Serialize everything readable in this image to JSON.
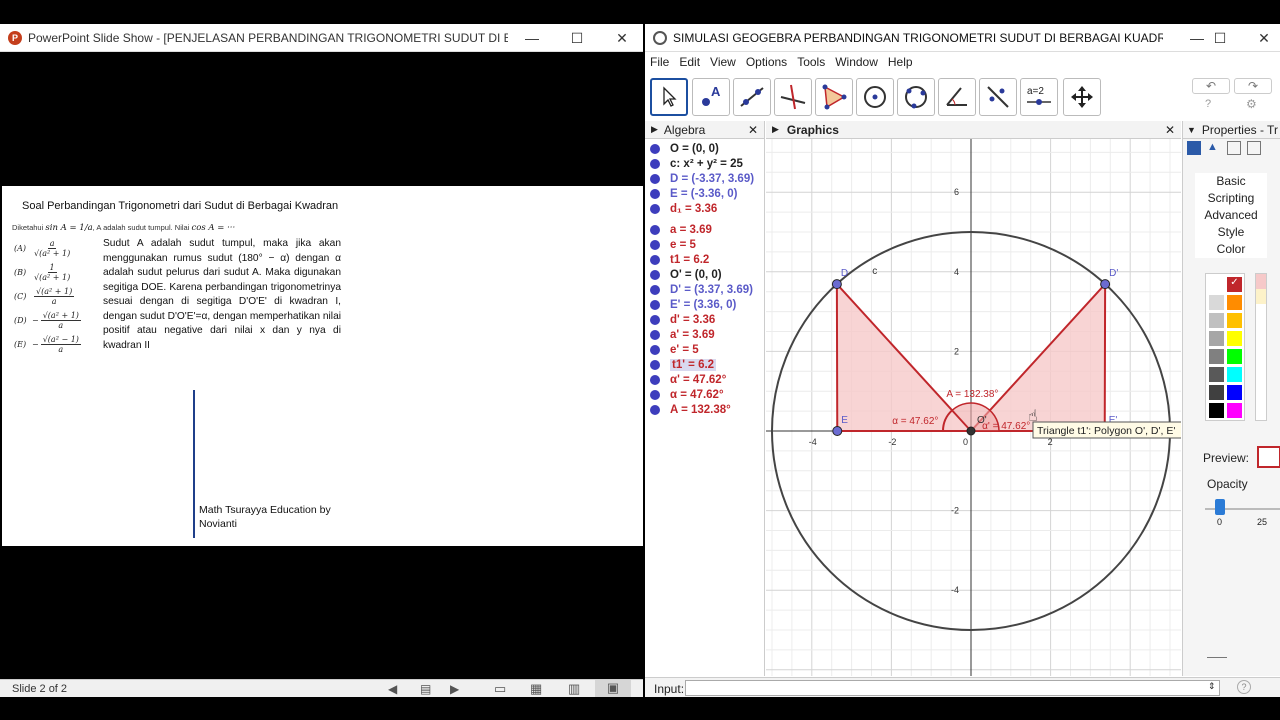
{
  "ppt": {
    "title": "PowerPoint Slide Show - [PENJELASAN PERBANDINGAN TRIGONOMETRI SUDUT DI BERBAGAI...",
    "slide_heading": "Soal Perbandingan Trigonometri dari Sudut di Berbagai Kwadran",
    "question_prefix": "Diketahui",
    "question_given": "sin A = 1/a",
    "question_mid": ", A adalah sudut tumpul. Nilai",
    "question_end": "cos A = ···",
    "options": [
      {
        "label": "(A)",
        "sign": "",
        "num": "a",
        "den": "√(a² + 1)"
      },
      {
        "label": "(B)",
        "sign": "",
        "num": "1",
        "den": "√(a² + 1)"
      },
      {
        "label": "(C)",
        "sign": "",
        "num": "√(a² + 1)",
        "den": "a"
      },
      {
        "label": "(D)",
        "sign": "−",
        "num": "√(a² + 1)",
        "den": "a"
      },
      {
        "label": "(E)",
        "sign": "−",
        "num": "√(a² − 1)",
        "den": "a"
      }
    ],
    "explanation": "Sudut A adalah sudut tumpul, maka jika akan menggunakan rumus sudut (180° − α) dengan α adalah sudut pelurus dari sudut A. Maka digunakan segitiga DOE. Karena perbandingan trigonometrinya sesuai dengan di segitiga D'O'E' di kwadran I, dengan sudut D'O'E'=α, dengan memperhatikan nilai positif atau negative dari nilai x dan y nya di kwadran II",
    "credit_line1": "Math Tsurayya Education by",
    "credit_line2": "Novianti",
    "status": "Slide 2 of 2"
  },
  "geogebra": {
    "title": "SIMULASI GEOGEBRA PERBANDINGAN TRIGONOMETRI SUDUT DI BERBAGAI KUADRAN.ggb",
    "menu": [
      "File",
      "Edit",
      "View",
      "Options",
      "Tools",
      "Window",
      "Help"
    ],
    "algebra_title": "Algebra",
    "graphics_title": "Graphics",
    "properties_title": "Properties - Tr",
    "algebra": [
      {
        "text": "O = (0, 0)",
        "color": "#222222",
        "dot": "#3d3dbd"
      },
      {
        "text": "c: x² + y² = 25",
        "color": "#222222",
        "dot": "#3d3dbd"
      },
      {
        "text": "D = (-3.37, 3.69)",
        "color": "#5a5ac8",
        "dot": "#3d3dbd"
      },
      {
        "text": "E = (-3.36, 0)",
        "color": "#5a5ac8",
        "dot": "#3d3dbd"
      },
      {
        "text": "d₁ = 3.36",
        "color": "#c0262b",
        "dot": "#3d3dbd"
      },
      {
        "text": "a = 3.69",
        "color": "#c0262b",
        "dot": "#3d3dbd"
      },
      {
        "text": "e = 5",
        "color": "#c0262b",
        "dot": "#3d3dbd"
      },
      {
        "text": "t1 = 6.2",
        "color": "#c0262b",
        "dot": "#3d3dbd"
      },
      {
        "text": "O' = (0, 0)",
        "color": "#222222",
        "dot": "#3d3dbd"
      },
      {
        "text": "D' = (3.37, 3.69)",
        "color": "#5a5ac8",
        "dot": "#3d3dbd"
      },
      {
        "text": "E' = (3.36, 0)",
        "color": "#5a5ac8",
        "dot": "#3d3dbd"
      },
      {
        "text": "d' = 3.36",
        "color": "#c0262b",
        "dot": "#3d3dbd"
      },
      {
        "text": "a' = 3.69",
        "color": "#c0262b",
        "dot": "#3d3dbd"
      },
      {
        "text": "e' = 5",
        "color": "#c0262b",
        "dot": "#3d3dbd"
      },
      {
        "text": "t1' = 6.2",
        "color": "#c0262b",
        "dot": "#3d3dbd",
        "selected": true
      },
      {
        "text": "α' = 47.62°",
        "color": "#c0262b",
        "dot": "#3d3dbd"
      },
      {
        "text": "α = 47.62°",
        "color": "#c0262b",
        "dot": "#3d3dbd"
      },
      {
        "text": "A = 132.38°",
        "color": "#c0262b",
        "dot": "#3d3dbd"
      }
    ],
    "points": [
      {
        "name": "D",
        "x": -3.37,
        "y": 3.69
      },
      {
        "name": "E",
        "x": -3.36,
        "y": 0
      },
      {
        "name": "D'",
        "x": 3.37,
        "y": 3.69
      },
      {
        "name": "E'",
        "x": 3.36,
        "y": 0
      },
      {
        "name": "O'",
        "x": 0,
        "y": 0
      }
    ],
    "circle_label": "c",
    "circle_radius": 5,
    "x_ticks": [
      "-4",
      "-2",
      "0",
      "2"
    ],
    "y_ticks": [
      "6",
      "4",
      "2",
      "-2",
      "-4"
    ],
    "angle_labels": {
      "A": "A = 132.38°",
      "alpha": "α = 47.62°",
      "alpha_prime": "α' = 47.62°"
    },
    "tooltip": "Triangle t1': Polygon O', D', E'",
    "prop_tabs": [
      "Basic",
      "Scripting",
      "Advanced",
      "Style",
      "Color"
    ],
    "preview_label": "Preview:",
    "opacity_label": "Opacity",
    "opacity_ticks": [
      "0",
      "25"
    ],
    "input_label": "Input:",
    "accent": "#c0262b",
    "fill": "#f6c9c9"
  }
}
